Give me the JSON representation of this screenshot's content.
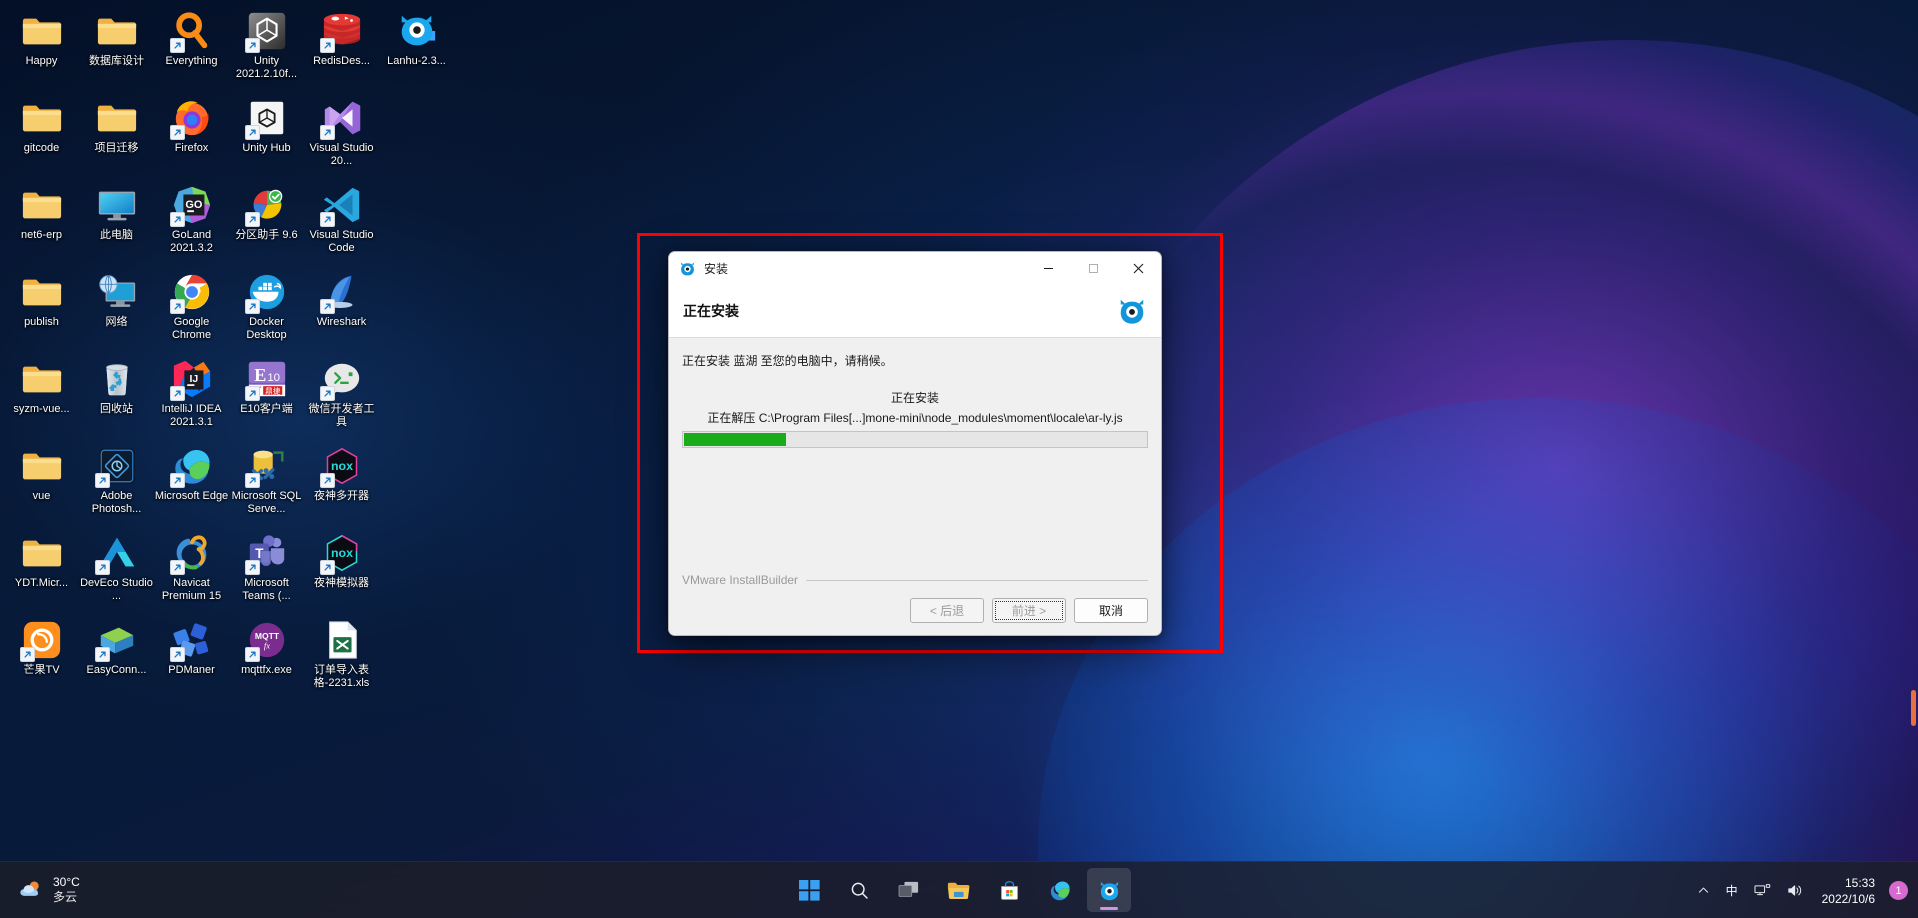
{
  "desktop": {
    "icons": [
      {
        "label": "Happy",
        "icon": "folder-icon",
        "shortcut": false
      },
      {
        "label": "数据库设计",
        "icon": "folder-icon",
        "shortcut": false
      },
      {
        "label": "Everything",
        "icon": "everything-icon",
        "shortcut": true
      },
      {
        "label": "Unity 2021.2.10f...",
        "icon": "unity-icon",
        "shortcut": true
      },
      {
        "label": "RedisDes...",
        "icon": "redis-desktop-icon",
        "shortcut": true
      },
      {
        "label": "Lanhu-2.3...",
        "icon": "lanhu-icon",
        "shortcut": false
      },
      {
        "label": "gitcode",
        "icon": "folder-icon",
        "shortcut": false
      },
      {
        "label": "项目迁移",
        "icon": "folder-icon",
        "shortcut": false
      },
      {
        "label": "Firefox",
        "icon": "firefox-icon",
        "shortcut": true
      },
      {
        "label": "Unity Hub",
        "icon": "unity-hub-icon",
        "shortcut": true
      },
      {
        "label": "Visual Studio 20...",
        "icon": "visual-studio-icon",
        "shortcut": true
      },
      {
        "label": "",
        "icon": "none",
        "shortcut": false
      },
      {
        "label": "net6-erp",
        "icon": "folder-icon",
        "shortcut": false
      },
      {
        "label": "此电脑",
        "icon": "this-pc-icon",
        "shortcut": false
      },
      {
        "label": "GoLand 2021.3.2",
        "icon": "goland-icon",
        "shortcut": true
      },
      {
        "label": "分区助手 9.6",
        "icon": "partition-assistant-icon",
        "shortcut": true
      },
      {
        "label": "Visual Studio Code",
        "icon": "vscode-icon",
        "shortcut": true
      },
      {
        "label": "",
        "icon": "none",
        "shortcut": false
      },
      {
        "label": "publish",
        "icon": "folder-icon",
        "shortcut": false
      },
      {
        "label": "网络",
        "icon": "network-icon",
        "shortcut": false
      },
      {
        "label": "Google Chrome",
        "icon": "chrome-icon",
        "shortcut": true
      },
      {
        "label": "Docker Desktop",
        "icon": "docker-icon",
        "shortcut": true
      },
      {
        "label": "Wireshark",
        "icon": "wireshark-icon",
        "shortcut": true
      },
      {
        "label": "",
        "icon": "none",
        "shortcut": false
      },
      {
        "label": "syzm-vue...",
        "icon": "folder-icon",
        "shortcut": false
      },
      {
        "label": "回收站",
        "icon": "recycle-bin-icon",
        "shortcut": false
      },
      {
        "label": "IntelliJ IDEA 2021.3.1",
        "icon": "intellij-idea-icon",
        "shortcut": true
      },
      {
        "label": "E10客户端",
        "icon": "e10-client-icon",
        "shortcut": true
      },
      {
        "label": "微信开发者工具",
        "icon": "wechat-devtools-icon",
        "shortcut": true
      },
      {
        "label": "",
        "icon": "none",
        "shortcut": false
      },
      {
        "label": "vue",
        "icon": "folder-icon",
        "shortcut": false
      },
      {
        "label": "Adobe Photosh...",
        "icon": "photoshop-icon",
        "shortcut": true
      },
      {
        "label": "Microsoft Edge",
        "icon": "edge-icon",
        "shortcut": true
      },
      {
        "label": "Microsoft SQL Serve...",
        "icon": "sql-server-icon",
        "shortcut": true
      },
      {
        "label": "夜神多开器",
        "icon": "nox-multi-icon",
        "shortcut": true
      },
      {
        "label": "",
        "icon": "none",
        "shortcut": false
      },
      {
        "label": "YDT.Micr...",
        "icon": "folder-icon",
        "shortcut": false
      },
      {
        "label": "DevEco Studio ...",
        "icon": "deveco-studio-icon",
        "shortcut": true
      },
      {
        "label": "Navicat Premium 15",
        "icon": "navicat-icon",
        "shortcut": true
      },
      {
        "label": "Microsoft Teams (...",
        "icon": "teams-icon",
        "shortcut": true
      },
      {
        "label": "夜神模拟器",
        "icon": "nox-player-icon",
        "shortcut": true
      },
      {
        "label": "",
        "icon": "none",
        "shortcut": false
      },
      {
        "label": "芒果TV",
        "icon": "mangotv-icon",
        "shortcut": true
      },
      {
        "label": "EasyConn...",
        "icon": "easyconnect-icon",
        "shortcut": true
      },
      {
        "label": "PDManer",
        "icon": "pdmaner-icon",
        "shortcut": true
      },
      {
        "label": "mqttfx.exe",
        "icon": "mqttfx-icon",
        "shortcut": true
      },
      {
        "label": "订单导入表格-2231.xls",
        "icon": "excel-file-icon",
        "shortcut": false
      },
      {
        "label": "",
        "icon": "none",
        "shortcut": false
      }
    ]
  },
  "installer": {
    "window_title": "安装",
    "header_title": "正在安装",
    "install_message": "正在安装 蓝湖 至您的电脑中，请稍候。",
    "status_label": "正在安装",
    "extract_line": "正在解压 C:\\Program Files[...]mone-mini\\node_modules\\moment\\locale\\ar-ly.js",
    "progress_percent": 22,
    "brand": "VMware InstallBuilder",
    "buttons": {
      "back": "< 后退",
      "next": "前进 >",
      "cancel": "取消"
    },
    "title_buttons": {
      "minimize": "minimize-icon",
      "maximize": "maximize-icon",
      "close": "close-icon"
    },
    "colors": {
      "progress_fill": "#1aab1a",
      "highlight_border": "#ff0000"
    }
  },
  "taskbar": {
    "weather": {
      "temperature": "30°C",
      "condition": "多云",
      "icon": "weather-cloudy-sun-icon"
    },
    "center_items": [
      {
        "name": "start-button",
        "icon": "windows-logo-icon",
        "active": false
      },
      {
        "name": "search-button",
        "icon": "search-icon",
        "active": false
      },
      {
        "name": "task-view-button",
        "icon": "task-view-icon",
        "active": false
      },
      {
        "name": "file-explorer-button",
        "icon": "folder-icon",
        "active": false
      },
      {
        "name": "microsoft-store-button",
        "icon": "store-icon",
        "active": false
      },
      {
        "name": "edge-button",
        "icon": "edge-icon",
        "active": false
      },
      {
        "name": "lanhu-installer-button",
        "icon": "lanhu-icon",
        "active": true
      }
    ],
    "tray": {
      "chevron": "chevron-up-icon",
      "ime": "中",
      "network": "network-tray-icon",
      "volume": "volume-icon",
      "time": "15:33",
      "date": "2022/10/6",
      "notification_count": "1"
    }
  }
}
